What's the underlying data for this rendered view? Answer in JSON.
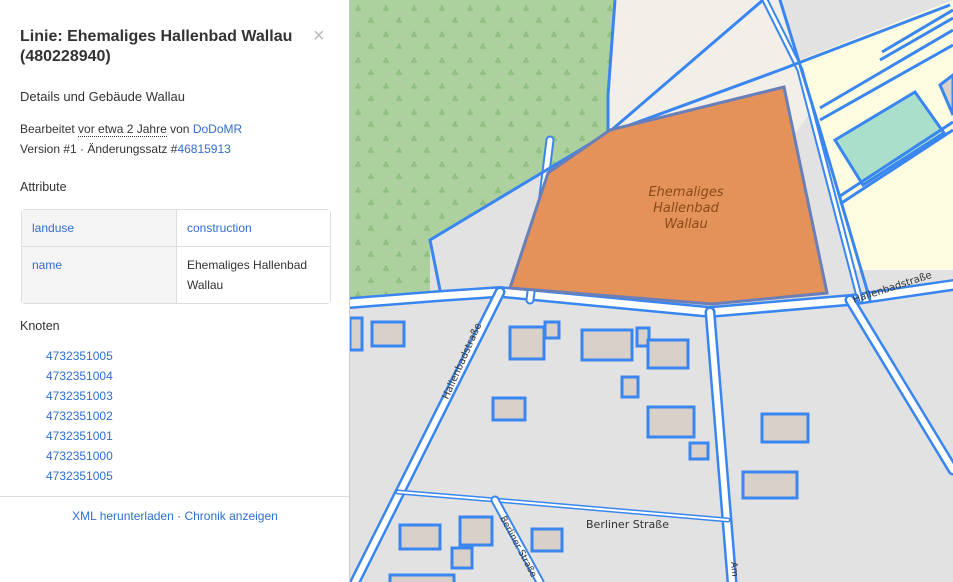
{
  "sidebar": {
    "title": "Linie: Ehemaliges Hallenbad Wallau (480228940)",
    "close_symbol": "×",
    "description": "Details und Gebäude Wallau",
    "edited_prefix": "Bearbeitet",
    "edited_time": "vor etwa 2 Jahre",
    "edited_by_word": "von",
    "edited_user": "DoDoMR",
    "version_text": "Version #1 · Änderungssatz #",
    "changeset": "46815913",
    "attributes_heading": "Attribute",
    "attributes": [
      {
        "key": "landuse",
        "value": "construction"
      },
      {
        "key": "name",
        "value": "Ehemaliges Hallenbad Wallau"
      }
    ],
    "nodes_heading": "Knoten",
    "nodes": [
      "4732351005",
      "4732351004",
      "4732351003",
      "4732351002",
      "4732351001",
      "4732351000",
      "4732351005"
    ],
    "footer_download": "XML herunterladen",
    "footer_sep": " · ",
    "footer_history": "Chronik anzeigen"
  },
  "map": {
    "area_label": [
      "Ehemaliges",
      "Hallenbad",
      "Wallau"
    ],
    "street_hallenbadstrasse_left": "Hallenbadstraße",
    "street_hallenbadstrasse_right": "Hallenbadstraße",
    "street_berliner_1": "Berliner Straße",
    "street_berliner_2": "Berliner Straße",
    "street_partial": "Am",
    "colors": {
      "highlight": "#3a86f0",
      "construction": "#e4925a",
      "forest": "#add19e",
      "residential": "#e0dfdf",
      "industrial": "#fdfbe0",
      "pitch": "#aae0cb",
      "building": "#d9d0c9"
    }
  }
}
